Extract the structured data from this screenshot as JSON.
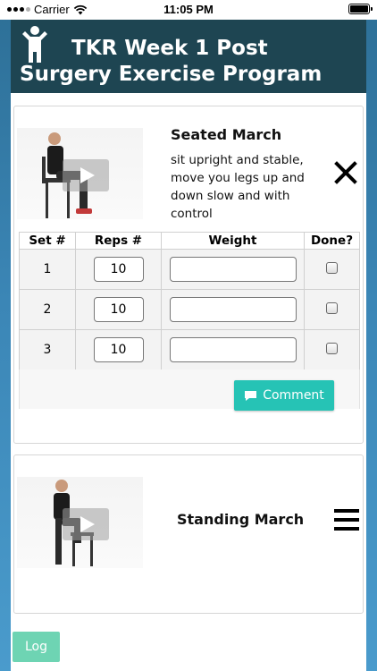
{
  "status_bar": {
    "carrier": "Carrier",
    "time": "11:05 PM"
  },
  "header": {
    "title": "TKR Week 1 Post Surgery Exercise Program",
    "logo_icon": "person-icon"
  },
  "exercises": [
    {
      "name": "Seated March",
      "description": "sit upright and stable, move you legs up and down slow and with control",
      "action_icon": "close-icon",
      "table": {
        "headers": [
          "Set #",
          "Reps #",
          "Weight",
          "Done?"
        ],
        "rows": [
          {
            "set": "1",
            "reps": "10",
            "weight": "",
            "done": false
          },
          {
            "set": "2",
            "reps": "10",
            "weight": "",
            "done": false
          },
          {
            "set": "3",
            "reps": "10",
            "weight": "",
            "done": false
          }
        ]
      },
      "comment_label": "Comment"
    },
    {
      "name": "Standing March",
      "action_icon": "menu-icon"
    }
  ],
  "footer": {
    "log_label": "Log"
  },
  "colors": {
    "header_bg": "#1e4552",
    "comment_button": "#26c3b5",
    "log_button": "#6ed4b3"
  }
}
